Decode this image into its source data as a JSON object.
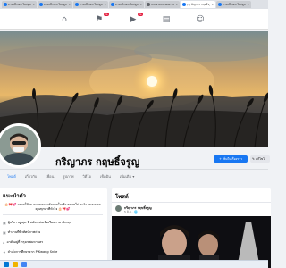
{
  "browser": {
    "tabs": [
      {
        "title": "ทรงแม็กเดล โฮสตูแท็บ",
        "active": false
      },
      {
        "title": "ทรงแม็กเดล โฮสตูแท็บ",
        "active": false
      },
      {
        "title": "ทรงแม็กเดล โฮสตูแท็บ",
        "active": false
      },
      {
        "title": "ทรงแม็กเดล โฮสตูแท็บ",
        "active": false
      },
      {
        "title": "Ultra Business Suite",
        "active": false
      },
      {
        "title": "(7) ศิญาภร กฤษธิ์จรูญ | Face",
        "active": true
      },
      {
        "title": "ทรงแม็กเดล โฮสตูแท็บ",
        "active": false
      }
    ]
  },
  "nav": {
    "icons": [
      "home-icon",
      "flag-icon",
      "video-icon",
      "marketplace-icon",
      "groups-icon"
    ],
    "badges": {
      "flag": "9+",
      "video": "9+"
    }
  },
  "profile": {
    "name": "กริญาภร กฤษธิ์จรูญ",
    "add_story_label": "+ เพิ่มในเรื่องราว",
    "edit_label": "✎ แก้ไขโ"
  },
  "profile_tabs": [
    "โพสต์",
    "เกี่ยวกับ",
    "เพื่อน",
    "รูปภาพ",
    "วิดีโอ",
    "เช็คอิน",
    "เพิ่มเติม ▾"
  ],
  "intro": {
    "title": "แนะนำตัว",
    "bio": "🎂🎀💕 อยากให้ผม ถนอมความรักจากใจจริง ตลอดไป ระวัง ผมจะบอกคุณทุกนาทีหัวใจ 🎂🎀💕",
    "rows": [
      "ผู้บริหารสูงสุด ที่ สมัครเล่นเพื่อเรียนภาษาอังกฤษ",
      "ทำงานที่ทิวทัศน์ภาพถ่าย",
      "อาศัยอยู่ที่ กรุงเทพมหานคร",
      "สำเร็จการศึกษาจาก P Kwang Snile"
    ]
  },
  "posts": {
    "title": "โพสต์",
    "author": "กริญาภร กฤษธิ์จรูญ",
    "date": "5 มิ.ย. · 🌐"
  },
  "colors": {
    "accent": "#1877f2",
    "badge": "#e41e3f"
  }
}
